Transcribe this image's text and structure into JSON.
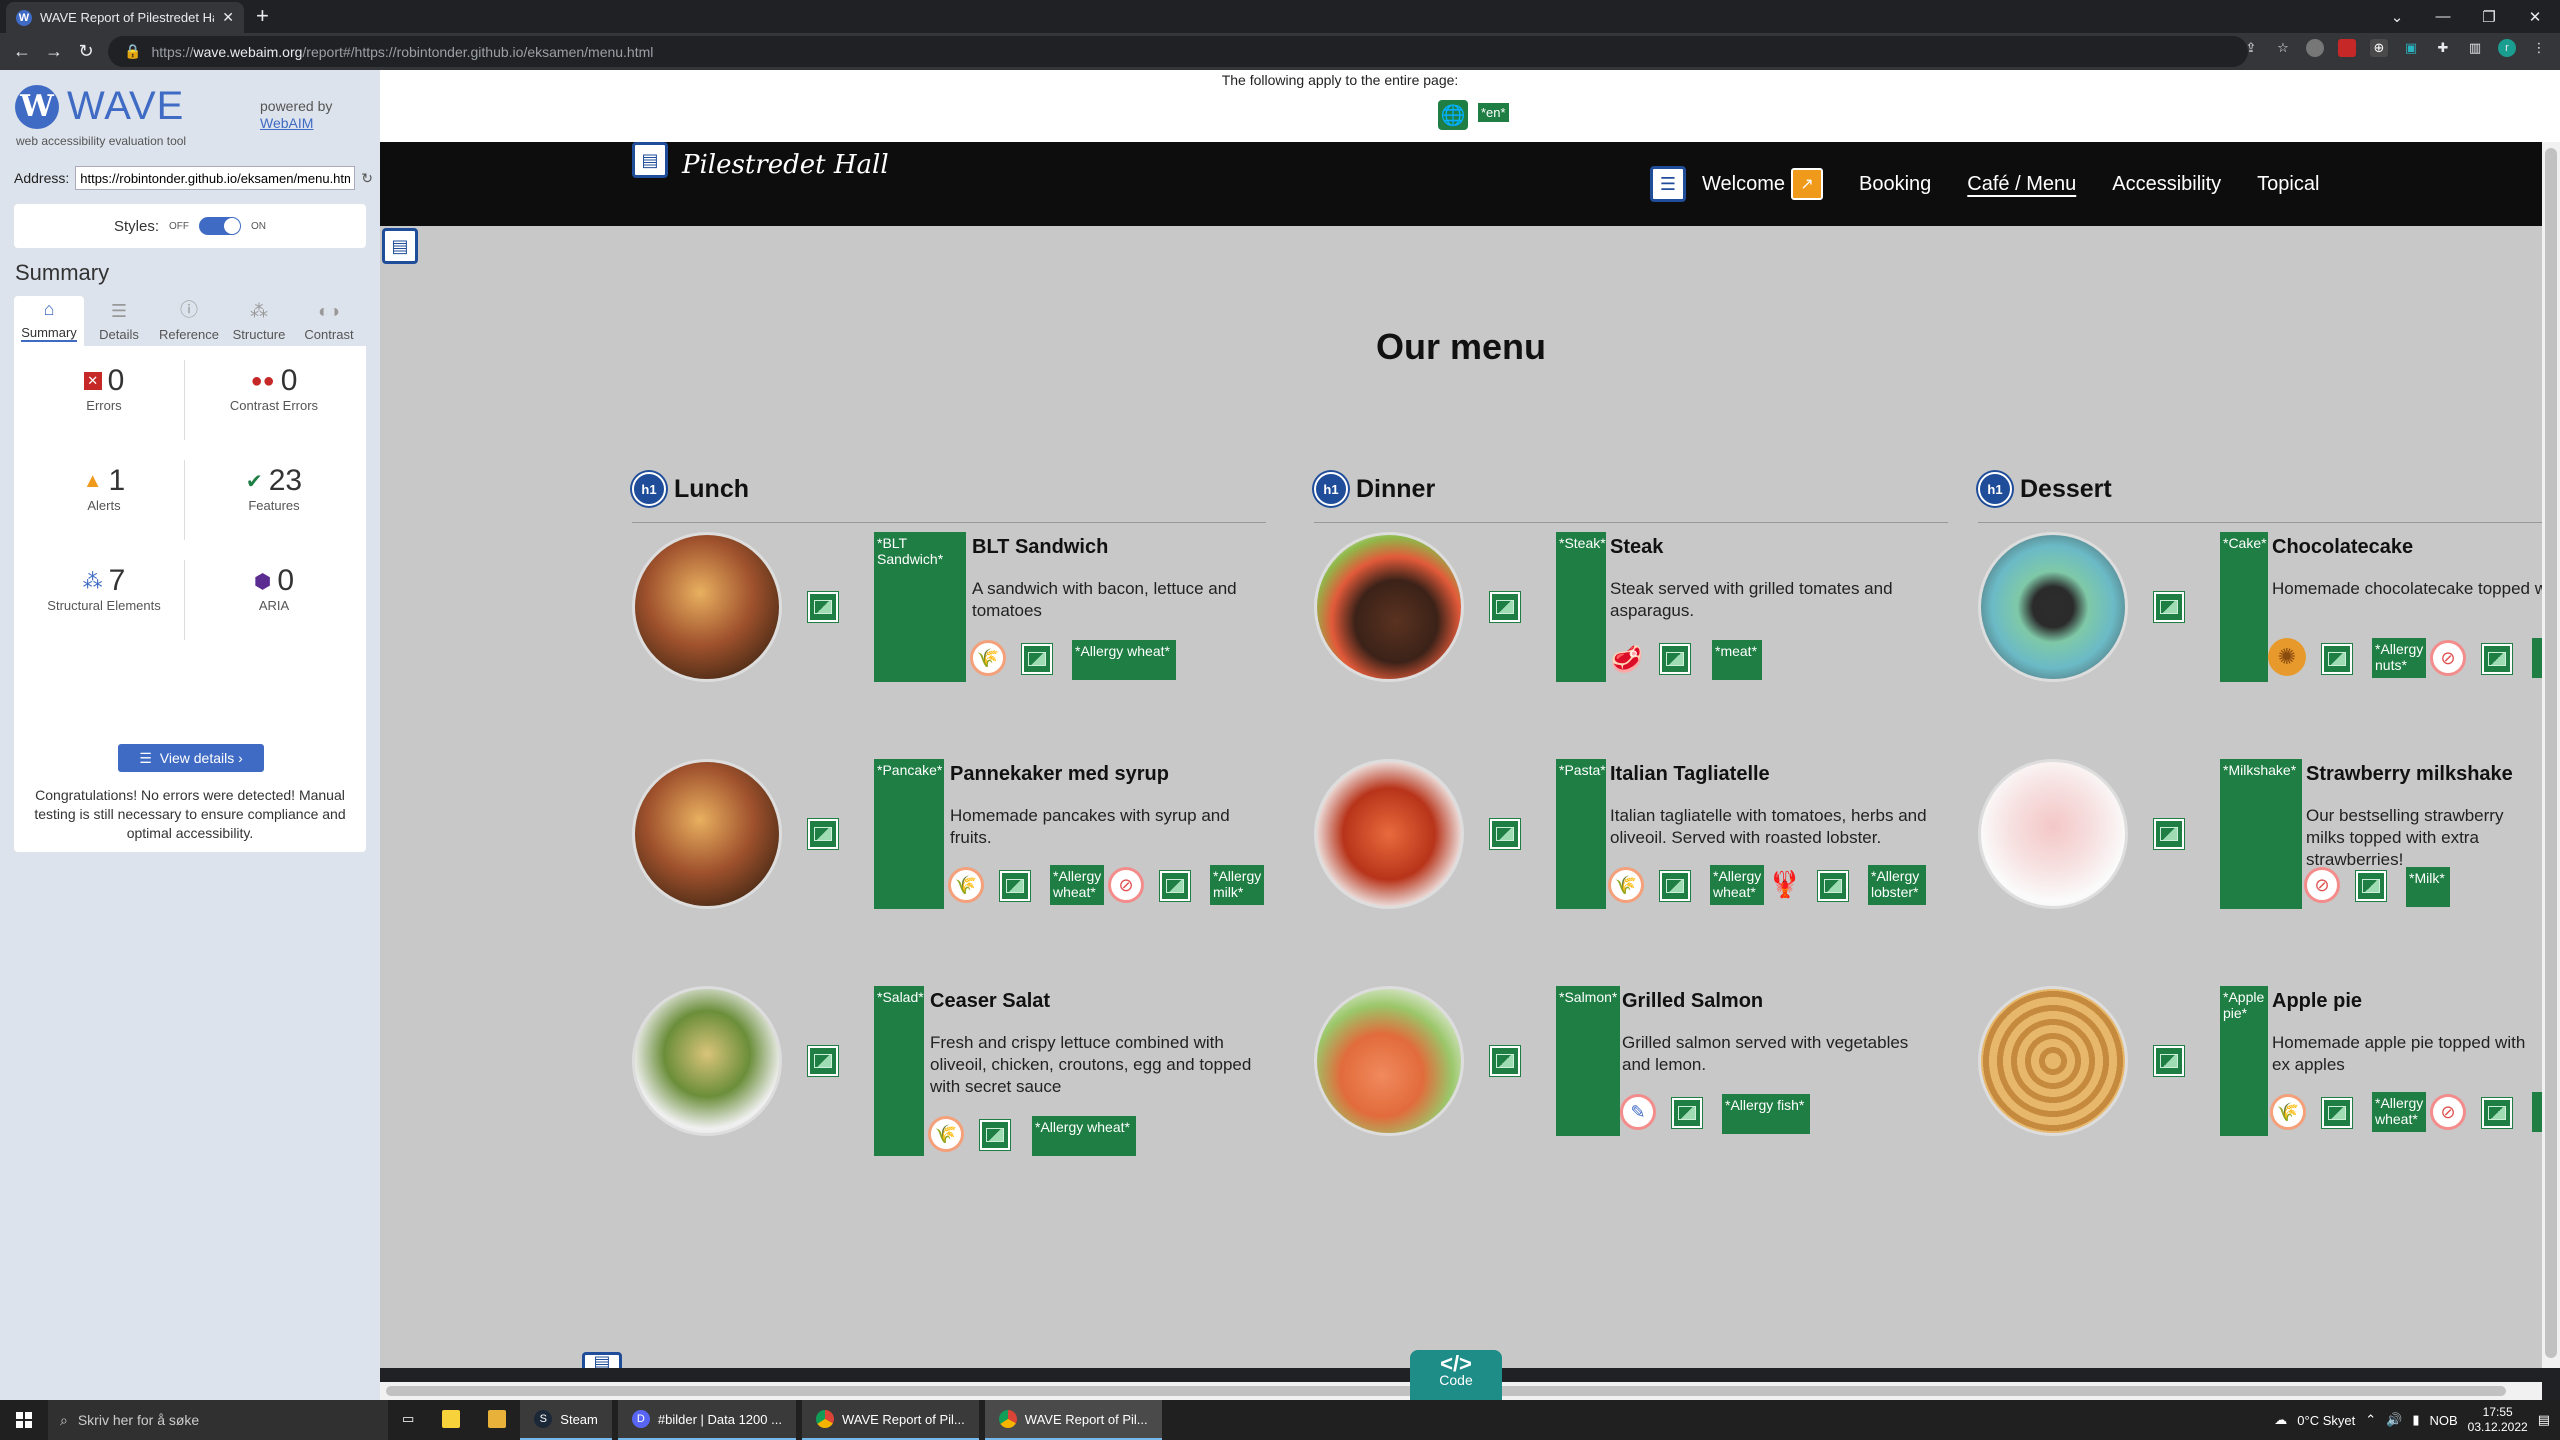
{
  "browser": {
    "tab_title": "WAVE Report of Pilestredet Hall",
    "url_prefix": "https://",
    "url_host": "wave.webaim.org",
    "url_rest": "/report#/https://robintonder.github.io/eksamen/menu.html"
  },
  "wave": {
    "logo_text": "WAVE",
    "logo_sub": "web accessibility evaluation tool",
    "powered_by": "powered by",
    "webaim": "WebAIM",
    "address_label": "Address:",
    "address_value": "https://robintonder.github.io/eksamen/menu.html",
    "styles_label": "Styles:",
    "styles_off": "OFF",
    "styles_on": "ON",
    "summary_title": "Summary",
    "tabs": [
      {
        "label": "Summary",
        "icon": "home-icon"
      },
      {
        "label": "Details",
        "icon": "list-icon"
      },
      {
        "label": "Reference",
        "icon": "info-icon"
      },
      {
        "label": "Structure",
        "icon": "structure-icon"
      },
      {
        "label": "Contrast",
        "icon": "contrast-icon"
      }
    ],
    "stats": {
      "errors": {
        "value": "0",
        "label": "Errors"
      },
      "contrast": {
        "value": "0",
        "label": "Contrast Errors"
      },
      "alerts": {
        "value": "1",
        "label": "Alerts"
      },
      "features": {
        "value": "23",
        "label": "Features"
      },
      "structural": {
        "value": "7",
        "label": "Structural Elements"
      },
      "aria": {
        "value": "0",
        "label": "ARIA"
      }
    },
    "view_details": "View details ›",
    "congrats": "Congratulations! No errors were detected! Manual testing is still necessary to ensure compliance and optimal accessibility."
  },
  "page": {
    "apply_text": "The following apply to the entire page:",
    "lang_label": "*en*",
    "brand": "Pilestredet Hall",
    "nav": [
      "Welcome",
      "Booking",
      "Café / Menu",
      "Accessibility",
      "Topical"
    ],
    "menu_title": "Our menu",
    "h1_badge": "h1",
    "columns": {
      "lunch": {
        "title": "Lunch",
        "items": [
          {
            "alt": "*BLT Sandwich*",
            "name": "BLT Sandwich",
            "desc": "A sandwich with bacon, lettuce and tomatoes",
            "labels": [
              "*Allergy wheat*"
            ]
          },
          {
            "alt": "*Pancake*",
            "name": "Pannekaker med syrup",
            "desc": "Homemade pancakes with syrup and fruits.",
            "labels": [
              "*Allergy wheat*",
              "*Allergy milk*"
            ]
          },
          {
            "alt": "*Salad*",
            "name": "Ceaser Salat",
            "desc": "Fresh and crispy lettuce combined with oliveoil, chicken, croutons, egg and topped with secret sauce",
            "labels": [
              "*Allergy wheat*"
            ]
          }
        ]
      },
      "dinner": {
        "title": "Dinner",
        "items": [
          {
            "alt": "*Steak*",
            "name": "Steak",
            "desc": "Steak served with grilled tomates and asparagus.",
            "labels": [
              "*meat*"
            ]
          },
          {
            "alt": "*Pasta*",
            "name": "Italian Tagliatelle",
            "desc": "Italian tagliatelle with tomatoes, herbs and oliveoil. Served with roasted lobster.",
            "labels": [
              "*Allergy wheat*",
              "*Allergy lobster*"
            ]
          },
          {
            "alt": "*Salmon*",
            "name": "Grilled Salmon",
            "desc": "Grilled salmon served with vegetables and lemon.",
            "labels": [
              "*Allergy fish*"
            ]
          }
        ]
      },
      "dessert": {
        "title": "Dessert",
        "items": [
          {
            "alt": "*Cake*",
            "name": "Chocolatecake",
            "desc": "Homemade chocolatecake topped w freshly ground pistachio",
            "labels": [
              "*Allergy nuts*"
            ]
          },
          {
            "alt": "*Milkshake*",
            "name": "Strawberry milkshake",
            "desc": "Our bestselling strawberry milks topped with extra strawberries!",
            "labels": [
              "*Milk*"
            ]
          },
          {
            "alt": "*Apple pie*",
            "name": "Apple pie",
            "desc": "Homemade apple pie topped with ex apples",
            "labels": [
              "*Allergy wheat*"
            ]
          }
        ]
      }
    },
    "code_label": "Code",
    "code_glyph": "</>"
  },
  "taskbar": {
    "search_placeholder": "Skriv her for å søke",
    "apps": [
      {
        "label": "Steam"
      },
      {
        "label": "#bilder | Data 1200 ..."
      },
      {
        "label": "WAVE Report of Pil..."
      },
      {
        "label": "WAVE Report of Pil..."
      }
    ],
    "weather": "0°C  Skyet",
    "lang": "NOB",
    "time": "17:55",
    "date": "03.12.2022"
  },
  "colors": {
    "wave_blue": "#3f6bc4",
    "feature_green": "#1e7e43",
    "alert_orange": "#f09a1c",
    "page_bg": "#c8c8c8"
  }
}
